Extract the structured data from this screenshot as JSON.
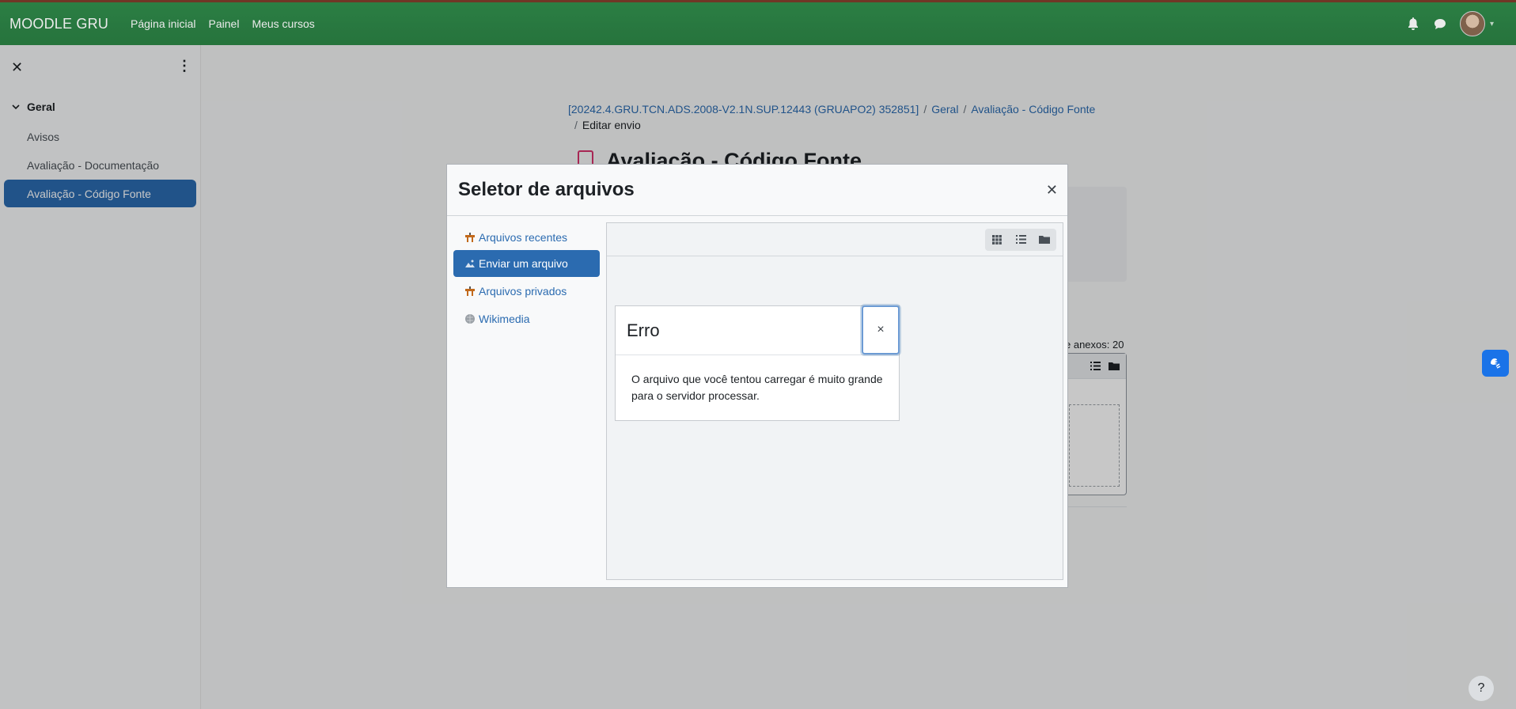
{
  "navbar": {
    "brand": "MOODLE GRU",
    "links": [
      "Página inicial",
      "Painel",
      "Meus cursos"
    ],
    "bell_icon": "bell-icon",
    "chat_icon": "chat-icon",
    "accent_color": "#2a7d42"
  },
  "drawer": {
    "section_title": "Geral",
    "items": [
      "Avisos",
      "Avaliação - Documentação",
      "Avaliação - Código Fonte"
    ],
    "active_index": 2
  },
  "breadcrumb": {
    "course": "[20242.4.GRU.TCN.ADS.2008-V2.1N.SUP.12443 (GRUAPO2) 352851]",
    "section": "Geral",
    "activity": "Avaliação - Código Fonte",
    "current": "Editar envio"
  },
  "page": {
    "title": "Avaliação - Código Fonte",
    "attachments_label": "e anexos: 20"
  },
  "file_picker": {
    "title": "Seletor de arquivos",
    "repositories": [
      "Arquivos recentes",
      "Enviar um arquivo",
      "Arquivos privados",
      "Wikimedia"
    ],
    "active_repository_index": 1
  },
  "error_dialog": {
    "title": "Erro",
    "close_symbol": "×",
    "message": "O arquivo que você tentou carregar é muito grande para o servidor processar."
  },
  "help_button": "?"
}
